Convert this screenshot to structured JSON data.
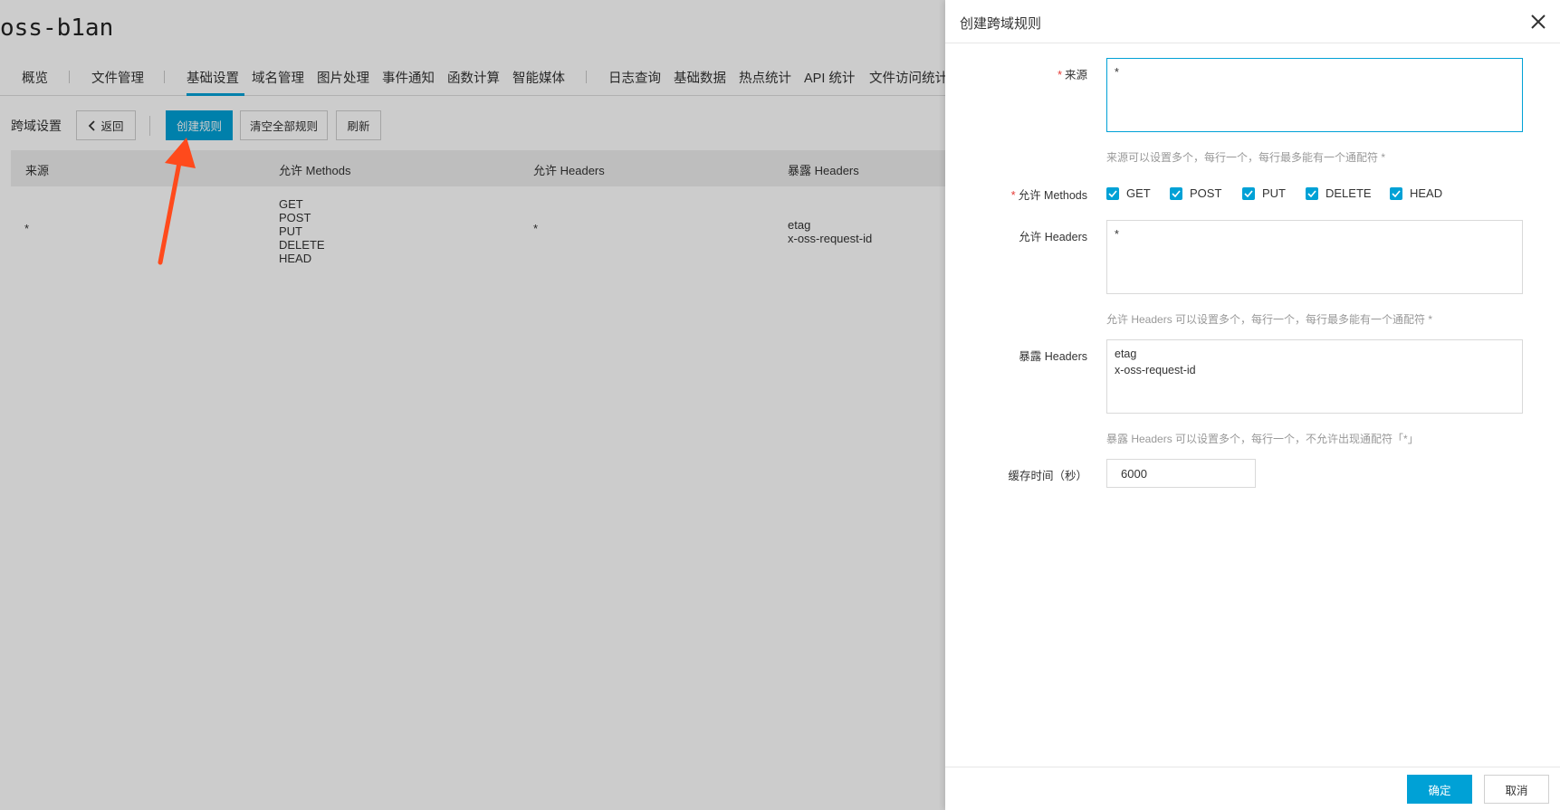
{
  "bucket": {
    "name": "oss-b1an"
  },
  "nav": {
    "items": [
      "概览",
      "文件管理",
      "基础设置",
      "域名管理",
      "图片处理",
      "事件通知",
      "函数计算",
      "智能媒体",
      "日志查询",
      "基础数据",
      "热点统计",
      "API 统计",
      "文件访问统计"
    ],
    "active": "基础设置"
  },
  "toolbar": {
    "section_label": "跨域设置",
    "back_label": "返回",
    "create_label": "创建规则",
    "clear_label": "清空全部规则",
    "refresh_label": "刷新"
  },
  "table": {
    "columns": [
      "来源",
      "允许 Methods",
      "允许 Headers",
      "暴露 Headers"
    ],
    "rows": [
      {
        "origin": "*",
        "methods": [
          "GET",
          "POST",
          "PUT",
          "DELETE",
          "HEAD"
        ],
        "allow_headers": "*",
        "expose_headers": [
          "etag",
          "x-oss-request-id"
        ]
      }
    ]
  },
  "annotation": {
    "arrow_color": "#ff4a1c"
  },
  "drawer": {
    "title": "创建跨域规则",
    "origin": {
      "label": "来源",
      "value": "*",
      "hint": "来源可以设置多个，每行一个，每行最多能有一个通配符 *"
    },
    "methods": {
      "label": "允许 Methods",
      "options": [
        {
          "label": "GET",
          "checked": true
        },
        {
          "label": "POST",
          "checked": true
        },
        {
          "label": "PUT",
          "checked": true
        },
        {
          "label": "DELETE",
          "checked": true
        },
        {
          "label": "HEAD",
          "checked": true
        }
      ]
    },
    "allow_headers": {
      "label": "允许 Headers",
      "value": "*",
      "hint": "允许 Headers 可以设置多个，每行一个，每行最多能有一个通配符 *"
    },
    "expose_headers": {
      "label": "暴露 Headers",
      "value": "etag\nx-oss-request-id",
      "hint": "暴露 Headers 可以设置多个，每行一个，不允许出现通配符「*」"
    },
    "cache": {
      "label": "缓存时间（秒）",
      "value": "6000"
    },
    "ok_label": "确定",
    "cancel_label": "取消"
  },
  "colors": {
    "accent": "#00a1d6",
    "required": "#e53935"
  }
}
